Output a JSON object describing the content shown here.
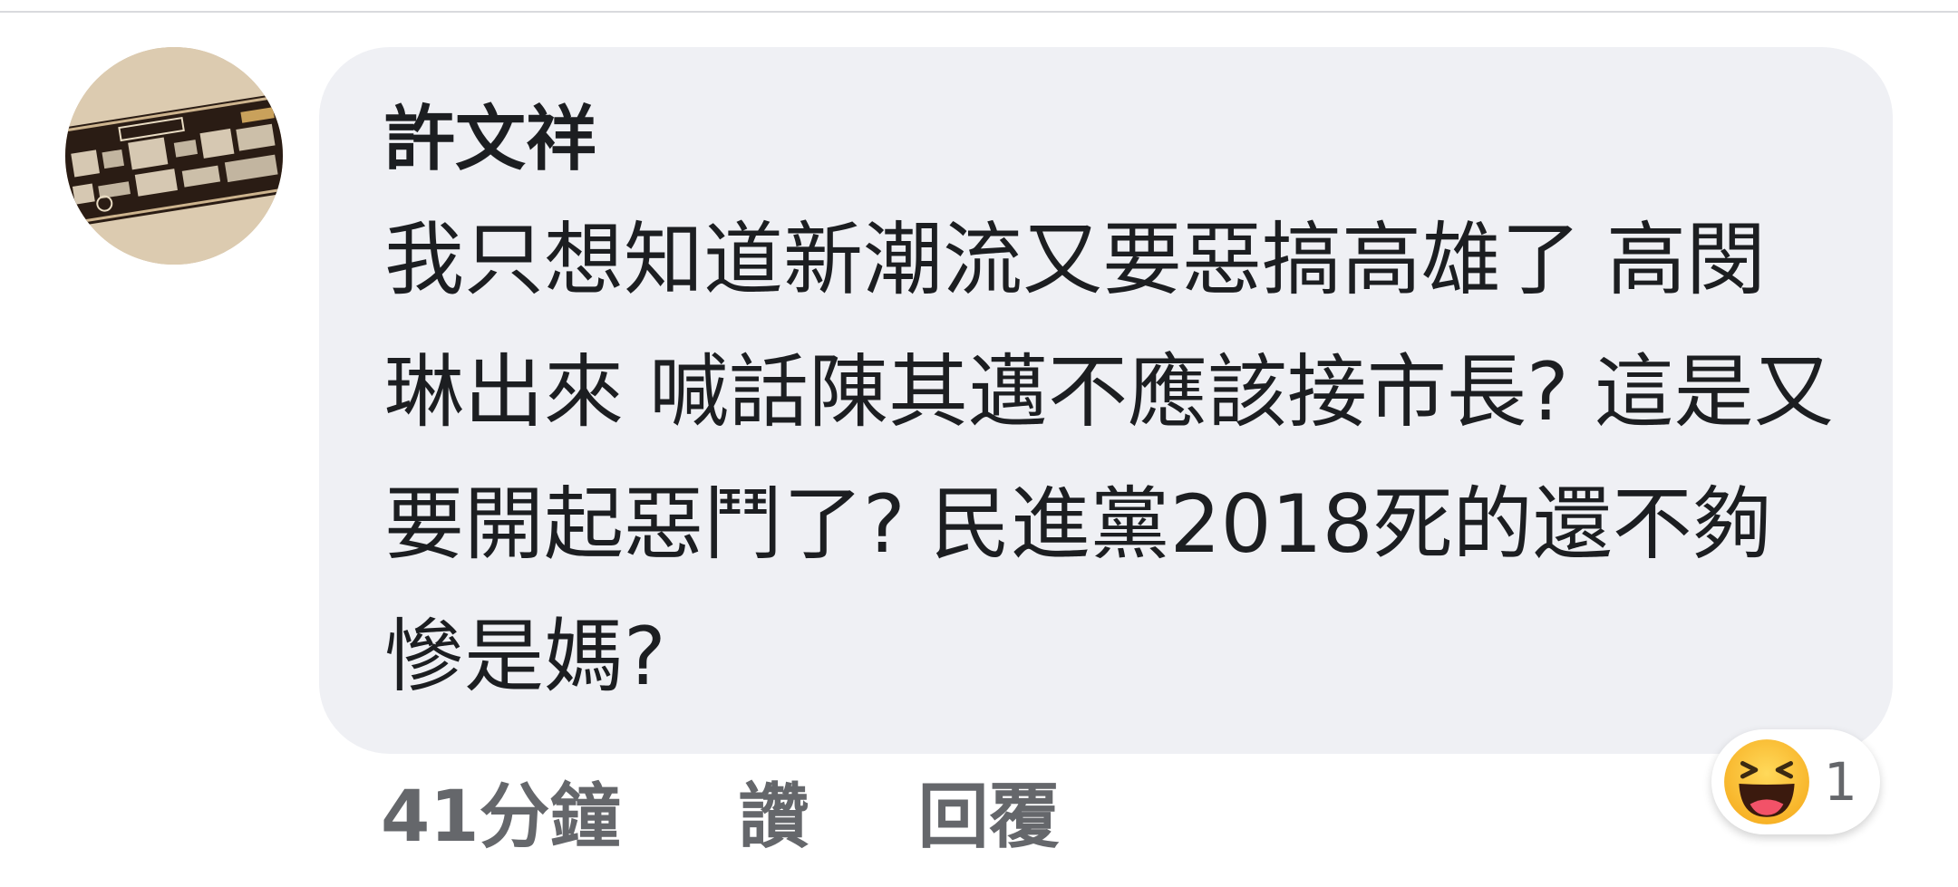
{
  "comment": {
    "author": "許文祥",
    "text": "我只想知道新潮流又要惡搞高雄了 高閔琳出來 喊話陳其邁不應該接市長? 這是又要開起惡鬥了? 民進黨2018死的還不夠慘是媽?",
    "timestamp": "41分鐘",
    "like_label": "讚",
    "reply_label": "回覆",
    "reaction": {
      "icon": "haha-emoji-icon",
      "count": "1"
    }
  },
  "colors": {
    "bubble_bg": "#eff0f4",
    "text": "#1c1e21",
    "meta_text": "#65676b",
    "reaction_yellow": "#f7b125"
  }
}
